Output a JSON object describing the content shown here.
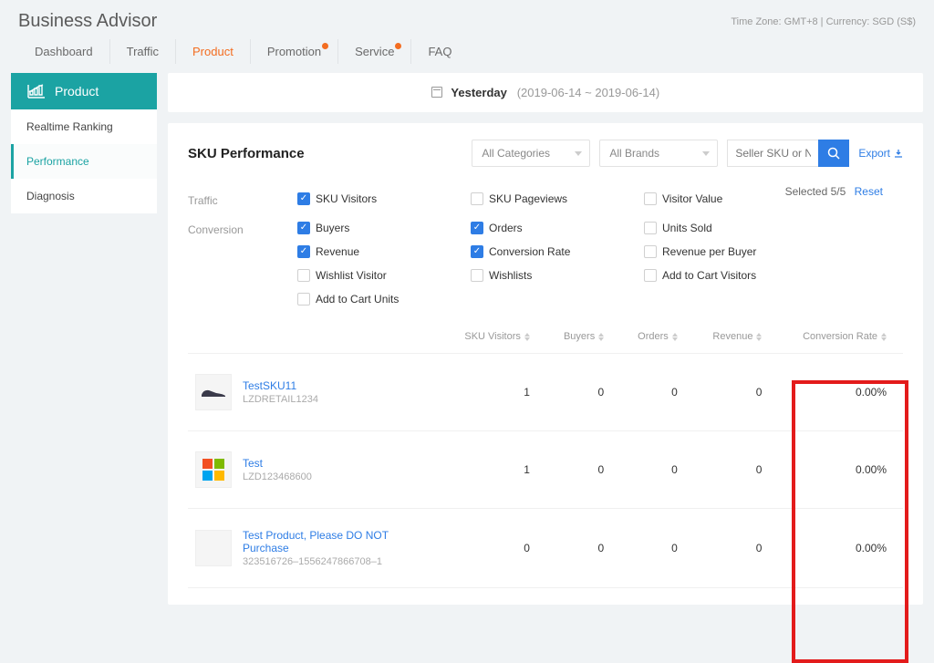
{
  "app_title": "Business Advisor",
  "tz_currency": "Time Zone: GMT+8 | Currency: SGD (S$)",
  "top_nav": [
    "Dashboard",
    "Traffic",
    "Product",
    "Promotion",
    "Service",
    "FAQ"
  ],
  "top_nav_active": 2,
  "top_nav_dots": [
    3,
    4
  ],
  "side_product_label": "Product",
  "side_nav": [
    "Realtime Ranking",
    "Performance",
    "Diagnosis"
  ],
  "side_nav_active": 1,
  "date": {
    "label": "Yesterday",
    "range": "(2019-06-14 ~ 2019-06-14)"
  },
  "sku_title": "SKU Performance",
  "filters": {
    "category": "All Categories",
    "brand": "All Brands",
    "search_placeholder": "Seller SKU or Name"
  },
  "export_label": "Export",
  "metric_groups": [
    {
      "label": "Traffic",
      "opts": [
        {
          "label": "SKU Visitors",
          "checked": true
        },
        {
          "label": "SKU Pageviews",
          "checked": false
        },
        {
          "label": "Visitor Value",
          "checked": false
        }
      ]
    },
    {
      "label": "Conversion",
      "opts": [
        {
          "label": "Buyers",
          "checked": true
        },
        {
          "label": "Orders",
          "checked": true
        },
        {
          "label": "Units Sold",
          "checked": false
        },
        {
          "label": "Revenue",
          "checked": true
        },
        {
          "label": "Conversion Rate",
          "checked": true
        },
        {
          "label": "Revenue per Buyer",
          "checked": false
        },
        {
          "label": "Wishlist Visitor",
          "checked": false
        },
        {
          "label": "Wishlists",
          "checked": false
        },
        {
          "label": "Add to Cart Visitors",
          "checked": false
        },
        {
          "label": "Add to Cart Units",
          "checked": false
        }
      ]
    }
  ],
  "selected_text": "Selected 5/5",
  "reset_label": "Reset",
  "columns": [
    "SKU Visitors",
    "Buyers",
    "Orders",
    "Revenue",
    "Conversion Rate"
  ],
  "rows": [
    {
      "name": "TestSKU11",
      "sku": "LZDRETAIL1234",
      "icon": "shoe",
      "vals": [
        "1",
        "0",
        "0",
        "0",
        "0.00%"
      ]
    },
    {
      "name": "Test",
      "sku": "LZD123468600",
      "icon": "ms",
      "vals": [
        "1",
        "0",
        "0",
        "0",
        "0.00%"
      ]
    },
    {
      "name": "Test Product, Please DO NOT Purchase",
      "sku": "323516726–1556247866708–1",
      "icon": "blank",
      "vals": [
        "0",
        "0",
        "0",
        "0",
        "0.00%"
      ]
    }
  ]
}
